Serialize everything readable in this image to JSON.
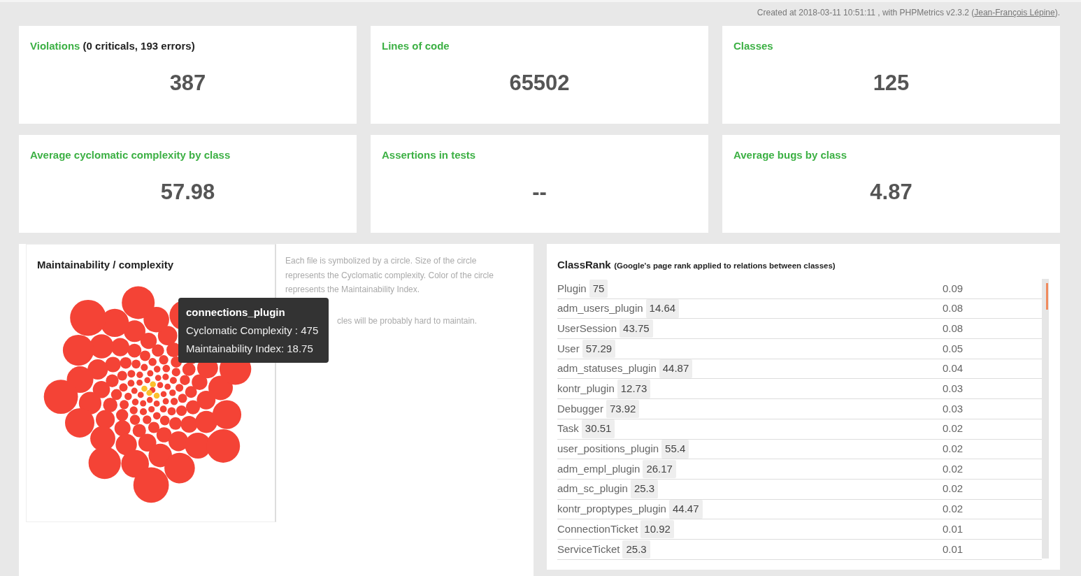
{
  "credit": {
    "prefix": "Created at 2018-03-11 10:51:11 , with PHPMetrics v2.3.2 (",
    "link": "Jean-François Lépine",
    "suffix": ")."
  },
  "cards": [
    {
      "title": "Violations",
      "title_note": "(0 criticals, 193 errors)",
      "value": "387"
    },
    {
      "title": "Lines of code",
      "value": "65502"
    },
    {
      "title": "Classes",
      "value": "125"
    },
    {
      "title": "Average cyclomatic complexity by class",
      "value": "57.98"
    },
    {
      "title": "Assertions in tests",
      "value": "--"
    },
    {
      "title": "Average bugs by class",
      "value": "4.87"
    }
  ],
  "maintainability": {
    "title": "Maintainability / complexity",
    "description": "Each file is symbolized by a circle. Size of the circle represents the Cyclomatic complexity. Color of the circle represents the Maintainability Index.",
    "note": "cles will be probably hard to maintain.",
    "tooltip": {
      "title": "connections_plugin",
      "lines": [
        "Cyclomatic Complexity : 475",
        "Maintainability Index: 18.75"
      ]
    }
  },
  "classrank": {
    "title": "ClassRank",
    "subtitle": "(Google's page rank applied to relations between classes)",
    "rows": [
      {
        "name": "Plugin",
        "value": "75",
        "rank": "0.09"
      },
      {
        "name": "adm_users_plugin",
        "value": "14.64",
        "rank": "0.08"
      },
      {
        "name": "UserSession",
        "value": "43.75",
        "rank": "0.08"
      },
      {
        "name": "User",
        "value": "57.29",
        "rank": "0.05"
      },
      {
        "name": "adm_statuses_plugin",
        "value": "44.87",
        "rank": "0.04"
      },
      {
        "name": "kontr_plugin",
        "value": "12.73",
        "rank": "0.03"
      },
      {
        "name": "Debugger",
        "value": "73.92",
        "rank": "0.03"
      },
      {
        "name": "Task",
        "value": "30.51",
        "rank": "0.02"
      },
      {
        "name": "user_positions_plugin",
        "value": "55.4",
        "rank": "0.02"
      },
      {
        "name": "adm_empl_plugin",
        "value": "26.17",
        "rank": "0.02"
      },
      {
        "name": "adm_sc_plugin",
        "value": "25.3",
        "rank": "0.02"
      },
      {
        "name": "kontr_proptypes_plugin",
        "value": "44.47",
        "rank": "0.02"
      },
      {
        "name": "ConnectionTicket",
        "value": "10.92",
        "rank": "0.01"
      },
      {
        "name": "ServiceTicket",
        "value": "25.3",
        "rank": "0.01"
      }
    ]
  }
}
